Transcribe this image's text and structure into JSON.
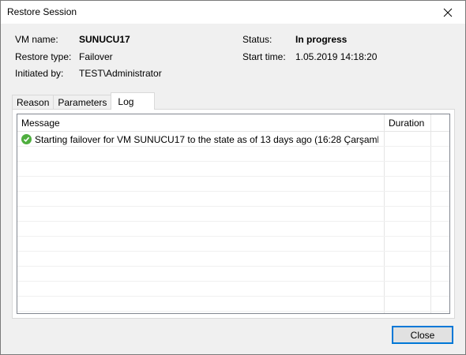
{
  "window": {
    "title": "Restore Session",
    "close_glyph": "✕"
  },
  "info": {
    "vm_name_label": "VM name:",
    "vm_name_value": "SUNUCU17",
    "restore_type_label": "Restore type:",
    "restore_type_value": "Failover",
    "initiated_by_label": "Initiated by:",
    "initiated_by_value": "TEST\\Administrator",
    "status_label": "Status:",
    "status_value": "In progress",
    "start_time_label": "Start time:",
    "start_time_value": "1.05.2019 14:18:20"
  },
  "tabs": [
    {
      "label": "Reason"
    },
    {
      "label": "Parameters"
    },
    {
      "label": "Log",
      "active": true
    }
  ],
  "log": {
    "columns": {
      "message": "Message",
      "duration": "Duration"
    },
    "rows": [
      {
        "status": "success",
        "icon": "checkmark-icon",
        "message": "Starting failover for VM SUNUCU17 to the state as of 13 days ago (16:28 Çarşamb...",
        "duration": ""
      }
    ],
    "empty_row_count": 11
  },
  "buttons": {
    "close": "Close"
  },
  "colors": {
    "accent": "#0078d7",
    "success": "#4fae3f"
  }
}
